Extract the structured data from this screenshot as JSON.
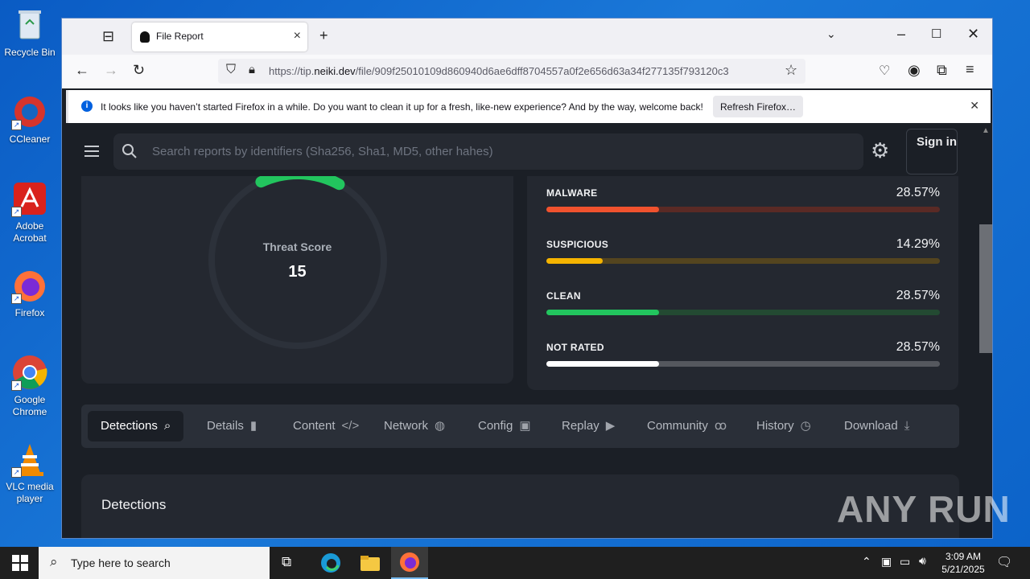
{
  "desktop": {
    "icons": [
      {
        "label": "Recycle Bin"
      },
      {
        "label": "CCleaner"
      },
      {
        "label": "Adobe Acrobat"
      },
      {
        "label": "Firefox"
      },
      {
        "label": "Google Chrome"
      },
      {
        "label": "VLC media player"
      }
    ]
  },
  "browser": {
    "tab_title": "File Report",
    "url_prefix": "https://tip.",
    "url_domain": "neiki.dev",
    "url_path": "/file/909f25010109d860940d6ae6dff8704557a0f2e656d63a34f277135f793120c3",
    "notification": {
      "message": "It looks like you haven’t started Firefox in a while. Do you want to clean it up for a fresh, like-new experience? And by the way, welcome back!",
      "button": "Refresh Firefox…"
    }
  },
  "page": {
    "search_placeholder": "Search reports by identifiers (Sha256, Sha1, MD5, other hahes)",
    "signin_label": "Sign in",
    "threat": {
      "label": "Threat Score",
      "value": "15",
      "score": 15
    },
    "categories": [
      {
        "label": "MALWARE",
        "percent": "28.57%",
        "fraction": 0.2857,
        "color": "#f0522e",
        "track": "#5a2a25"
      },
      {
        "label": "SUSPICIOUS",
        "percent": "14.29%",
        "fraction": 0.1429,
        "color": "#f5b400",
        "track": "#54451f"
      },
      {
        "label": "CLEAN",
        "percent": "28.57%",
        "fraction": 0.2857,
        "color": "#22c55e",
        "track": "#234a32"
      },
      {
        "label": "NOT RATED",
        "percent": "28.57%",
        "fraction": 0.2857,
        "color": "#ffffff",
        "track": "#55585e"
      }
    ],
    "tabs": [
      {
        "label": "Detections",
        "icon": "search-icon",
        "glyph": "⌕"
      },
      {
        "label": "Details",
        "icon": "document-icon",
        "glyph": "▮"
      },
      {
        "label": "Content",
        "icon": "code-icon",
        "glyph": "</>"
      },
      {
        "label": "Network",
        "icon": "globe-icon",
        "glyph": "◍"
      },
      {
        "label": "Config",
        "icon": "folder-gear-icon",
        "glyph": "▣"
      },
      {
        "label": "Replay",
        "icon": "play-screen-icon",
        "glyph": "▶"
      },
      {
        "label": "Community",
        "icon": "users-icon",
        "glyph": "ꝏ"
      },
      {
        "label": "History",
        "icon": "clock-icon",
        "glyph": "◷"
      },
      {
        "label": "Download",
        "icon": "download-icon",
        "glyph": "⤓"
      }
    ],
    "detections_heading": "Detections"
  },
  "watermark": "ANY RUN",
  "taskbar": {
    "search_placeholder": "Type here to search",
    "time": "3:09 AM",
    "date": "5/21/2025"
  }
}
